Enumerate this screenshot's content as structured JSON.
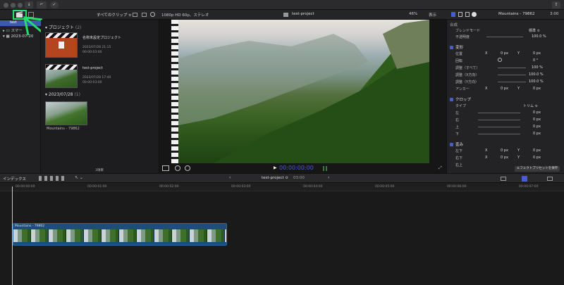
{
  "toolbar": {
    "key_label": "⌐",
    "check_icon": "check-circle-icon",
    "share_icon": "share-icon"
  },
  "browser": {
    "filter_label": "すべてのクリップ ≎",
    "section_projects": "プロジェクト",
    "section_projects_count": "(2)",
    "projects": [
      {
        "name": "名称未設定プロジェクト",
        "date": "2023/07/28 21:15",
        "duration": "00:00:03:00"
      },
      {
        "name": "test-project",
        "date": "2023/07/28 17:40",
        "duration": "00:00:03:00"
      }
    ],
    "section_date": "2023/07/28",
    "section_date_count": "(1)",
    "clip_name": "Mountains - 79862",
    "footer": "3項目"
  },
  "sidebar": {
    "items": [
      {
        "label": "test"
      },
      {
        "label": "スマー"
      },
      {
        "label": "2023-07-20"
      }
    ]
  },
  "viewer": {
    "format": "1080p HD 60p、ステレオ",
    "title": "test-project",
    "zoom": "46%",
    "view_label": "表示",
    "timecode": "00:00:00:00",
    "format_label": "≡"
  },
  "inspector": {
    "clip_title": "Mountains - 79862",
    "duration": "3:00",
    "compositing": "合成",
    "blend_mode_label": "ブレンドモード",
    "blend_mode_value": "標準 ≎",
    "opacity_label": "不透明度",
    "opacity_value": "100.0 %",
    "transform": "変形",
    "position_label": "位置",
    "position_x": "0 px",
    "position_y": "0 px",
    "rotation_label": "回転",
    "rotation_value": "0 °",
    "scale_all_label": "調整（すべて）",
    "scale_all_value": "100 %",
    "scale_x_label": "調整（X方向）",
    "scale_x_value": "100.0 %",
    "scale_y_label": "調整（Y方向）",
    "scale_y_value": "100.0 %",
    "anchor_label": "アンカー",
    "anchor_x": "0 px",
    "anchor_y": "0 px",
    "crop": "クロップ",
    "crop_type_label": "タイプ",
    "crop_type_value": "トリム ≎",
    "crop_left_label": "左",
    "crop_right_label": "右",
    "crop_top_label": "上",
    "crop_bottom_label": "下",
    "crop_value": "0 px",
    "distort": "歪み",
    "dist_bl_label": "左下",
    "dist_br_label": "右下",
    "dist_tr_label": "右上",
    "dist_x": "0 px",
    "dist_y": "0 px",
    "save_preset": "エフェクトプリセットを保存"
  },
  "timeline": {
    "index_label": "インデックス",
    "project": "test-project ≎",
    "duration": "03:00",
    "ruler": [
      "00:00:00:00",
      "00:00:01:00",
      "00:00:02:00",
      "00:00:03:00",
      "00:00:04:00",
      "00:00:05:00",
      "00:00:06:00",
      "00:00:07:00"
    ],
    "clip_label": "Mountains - 79862"
  },
  "colors": {
    "accent": "#4a5bd4",
    "highlight_green": "#22e06a",
    "clip_blue": "#1f4d7a"
  }
}
